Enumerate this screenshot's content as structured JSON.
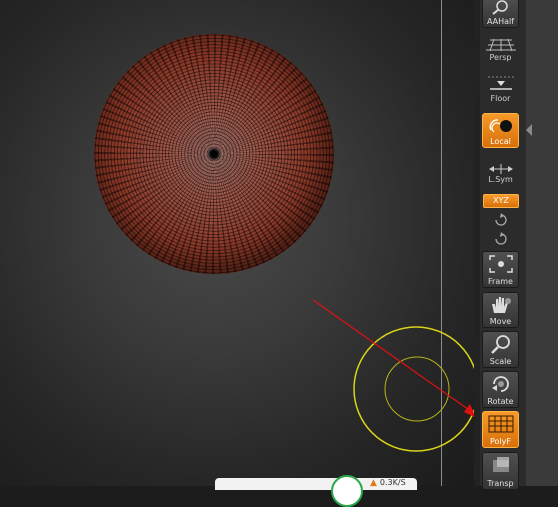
{
  "shelf": {
    "buttons": [
      {
        "id": "aahalf",
        "label": "AAHalf",
        "active": false,
        "icon": "magnifier-icon"
      },
      {
        "id": "persp",
        "label": "Persp",
        "active": false,
        "icon": "perspective-grid-icon"
      },
      {
        "id": "floor",
        "label": "Floor",
        "active": false,
        "icon": "floor-icon"
      },
      {
        "id": "local",
        "label": "Local",
        "active": true,
        "icon": "local-orbit-icon"
      },
      {
        "id": "lsym",
        "label": "L.Sym",
        "active": false,
        "icon": "symmetry-arrows-icon"
      },
      {
        "id": "frame",
        "label": "Frame",
        "active": false,
        "icon": "frame-icon"
      },
      {
        "id": "move",
        "label": "Move",
        "active": false,
        "icon": "hand-icon"
      },
      {
        "id": "scale",
        "label": "Scale",
        "active": false,
        "icon": "magnifier-icon"
      },
      {
        "id": "rotate",
        "label": "Rotate",
        "active": false,
        "icon": "rotate-icon"
      },
      {
        "id": "polyf",
        "label": "PolyF",
        "active": true,
        "icon": "polyframe-icon"
      },
      {
        "id": "transp",
        "label": "Transp",
        "active": false,
        "icon": "transparency-icon"
      }
    ],
    "xyz_label": "XYZ"
  },
  "status": {
    "text": "0.3K/S"
  },
  "colors": {
    "accent": "#f08a1c",
    "pointer": "#e01010",
    "brush_ring": "#d8d418",
    "mesh": "#8e3a29"
  }
}
